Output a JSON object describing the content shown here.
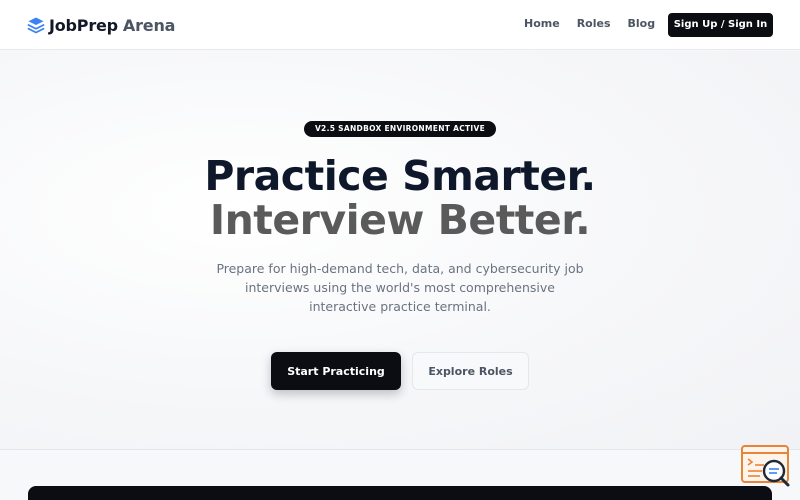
{
  "navbar": {
    "brand": {
      "name_part1": "JobPrep",
      "name_part2": "Arena",
      "logo_icon": "stacked-layers-icon"
    },
    "links": [
      {
        "label": "Home"
      },
      {
        "label": "Roles"
      },
      {
        "label": "Blog"
      }
    ],
    "signup_label": "Sign Up / Sign In"
  },
  "hero": {
    "badge": "V2.5 SANDBOX ENVIRONMENT ACTIVE",
    "headline_line1": "Practice Smarter.",
    "headline_line2": "Interview Better.",
    "subtitle": "Prepare for high-demand tech, data, and cybersecurity job interviews using the world's most comprehensive interactive practice terminal.",
    "primary_cta": "Start Practicing",
    "secondary_cta": "Explore Roles"
  },
  "floating_widget": {
    "icon": "terminal-search-icon",
    "accent_color": "#e8833a"
  },
  "colors": {
    "primary_dark": "#0b0d12",
    "headline_dark": "#0f172a",
    "headline_gray": "#5a5a5a",
    "logo_blue": "#3b82f6"
  }
}
